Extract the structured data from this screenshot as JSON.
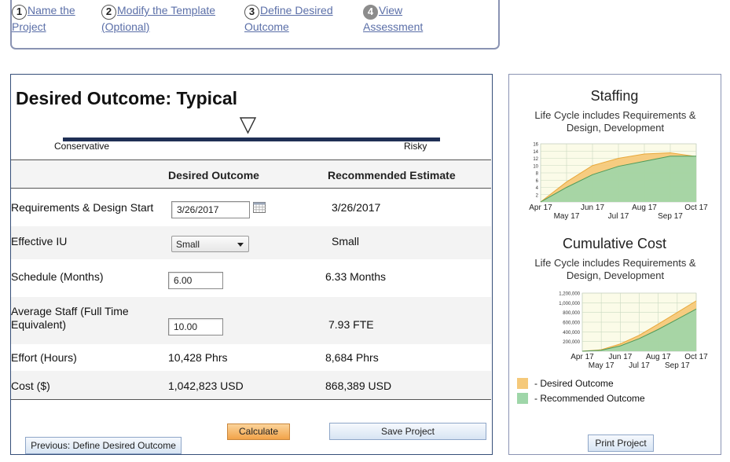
{
  "wizard": {
    "steps": [
      {
        "num": "1",
        "line1": "Name the",
        "line2": "Project"
      },
      {
        "num": "2",
        "line1": "Modify the Template",
        "line2": "(Optional)"
      },
      {
        "num": "3",
        "line1": "Define Desired",
        "line2": "Outcome"
      },
      {
        "num": "4",
        "line1": "View",
        "line2": "Assessment"
      }
    ]
  },
  "main": {
    "title": "Desired Outcome: Typical",
    "slider": {
      "left_label": "Conservative",
      "right_label": "Risky",
      "position": 0.5
    },
    "columns": {
      "desired": "Desired Outcome",
      "recommended": "Recommended Estimate"
    },
    "rows": [
      {
        "label": "Requirements & Design Start",
        "desired": "3/26/2017",
        "recommended": "3/26/2017"
      },
      {
        "label": "Effective IU",
        "desired": "Small",
        "recommended": "Small"
      },
      {
        "label": "Schedule (Months)",
        "desired": "6.00",
        "recommended": "6.33 Months"
      },
      {
        "label1": "Average Staff (Full Time",
        "label2": "Equivalent)",
        "desired": "10.00",
        "recommended": "7.93 FTE"
      },
      {
        "label": "Effort (Hours)",
        "desired": "10,428 Phrs",
        "recommended": "8,684 Phrs"
      },
      {
        "label": "Cost ($)",
        "desired": "1,042,823 USD",
        "recommended": "868,389 USD"
      }
    ],
    "buttons": {
      "calculate": "Calculate",
      "save": "Save Project",
      "previous": "Previous: Define Desired Outcome"
    }
  },
  "side": {
    "staffing_title": "Staffing",
    "staffing_sub1": "Life Cycle includes Requirements &",
    "staffing_sub2": "Design, Development",
    "cost_title": "Cumulative Cost",
    "cost_sub1": "Life Cycle includes Requirements &",
    "cost_sub2": "Design, Development",
    "legend": {
      "desired": "- Desired Outcome",
      "recommended": "- Recommended Outcome"
    },
    "print": "Print Project",
    "colors": {
      "desired": "#f5c97a",
      "recommended": "#9fd6a9"
    }
  },
  "chart_data": [
    {
      "type": "area",
      "title": "Staffing",
      "subtitle": "Life Cycle includes Requirements & Design, Development",
      "x": [
        "Apr 17",
        "May 17",
        "Jun 17",
        "Jul 17",
        "Aug 17",
        "Sep 17",
        "Oct 17"
      ],
      "ylim": [
        0,
        16
      ],
      "yticks": [
        "2",
        "4",
        "6",
        "8",
        "10",
        "12",
        "14",
        "16"
      ],
      "series": [
        {
          "name": "Desired Outcome",
          "values": [
            0,
            5.5,
            10,
            12,
            13.2,
            13.5,
            12.5
          ]
        },
        {
          "name": "Recommended Outcome",
          "values": [
            0,
            4,
            7.5,
            9.8,
            11.2,
            12.6,
            12.6
          ]
        }
      ]
    },
    {
      "type": "area",
      "title": "Cumulative Cost",
      "subtitle": "Life Cycle includes Requirements & Design, Development",
      "x": [
        "Apr 17",
        "May 17",
        "Jun 17",
        "Jul 17",
        "Aug 17",
        "Sep 17",
        "Oct 17"
      ],
      "ylim": [
        0,
        1200000
      ],
      "yticks": [
        "200,000",
        "400,000",
        "600,000",
        "800,000",
        "1,000,000",
        "1,200,000"
      ],
      "series": [
        {
          "name": "Desired Outcome",
          "values": [
            0,
            30000,
            150000,
            330000,
            560000,
            800000,
            1040000
          ]
        },
        {
          "name": "Recommended Outcome",
          "values": [
            0,
            20000,
            110000,
            260000,
            450000,
            660000,
            870000
          ]
        }
      ]
    }
  ]
}
